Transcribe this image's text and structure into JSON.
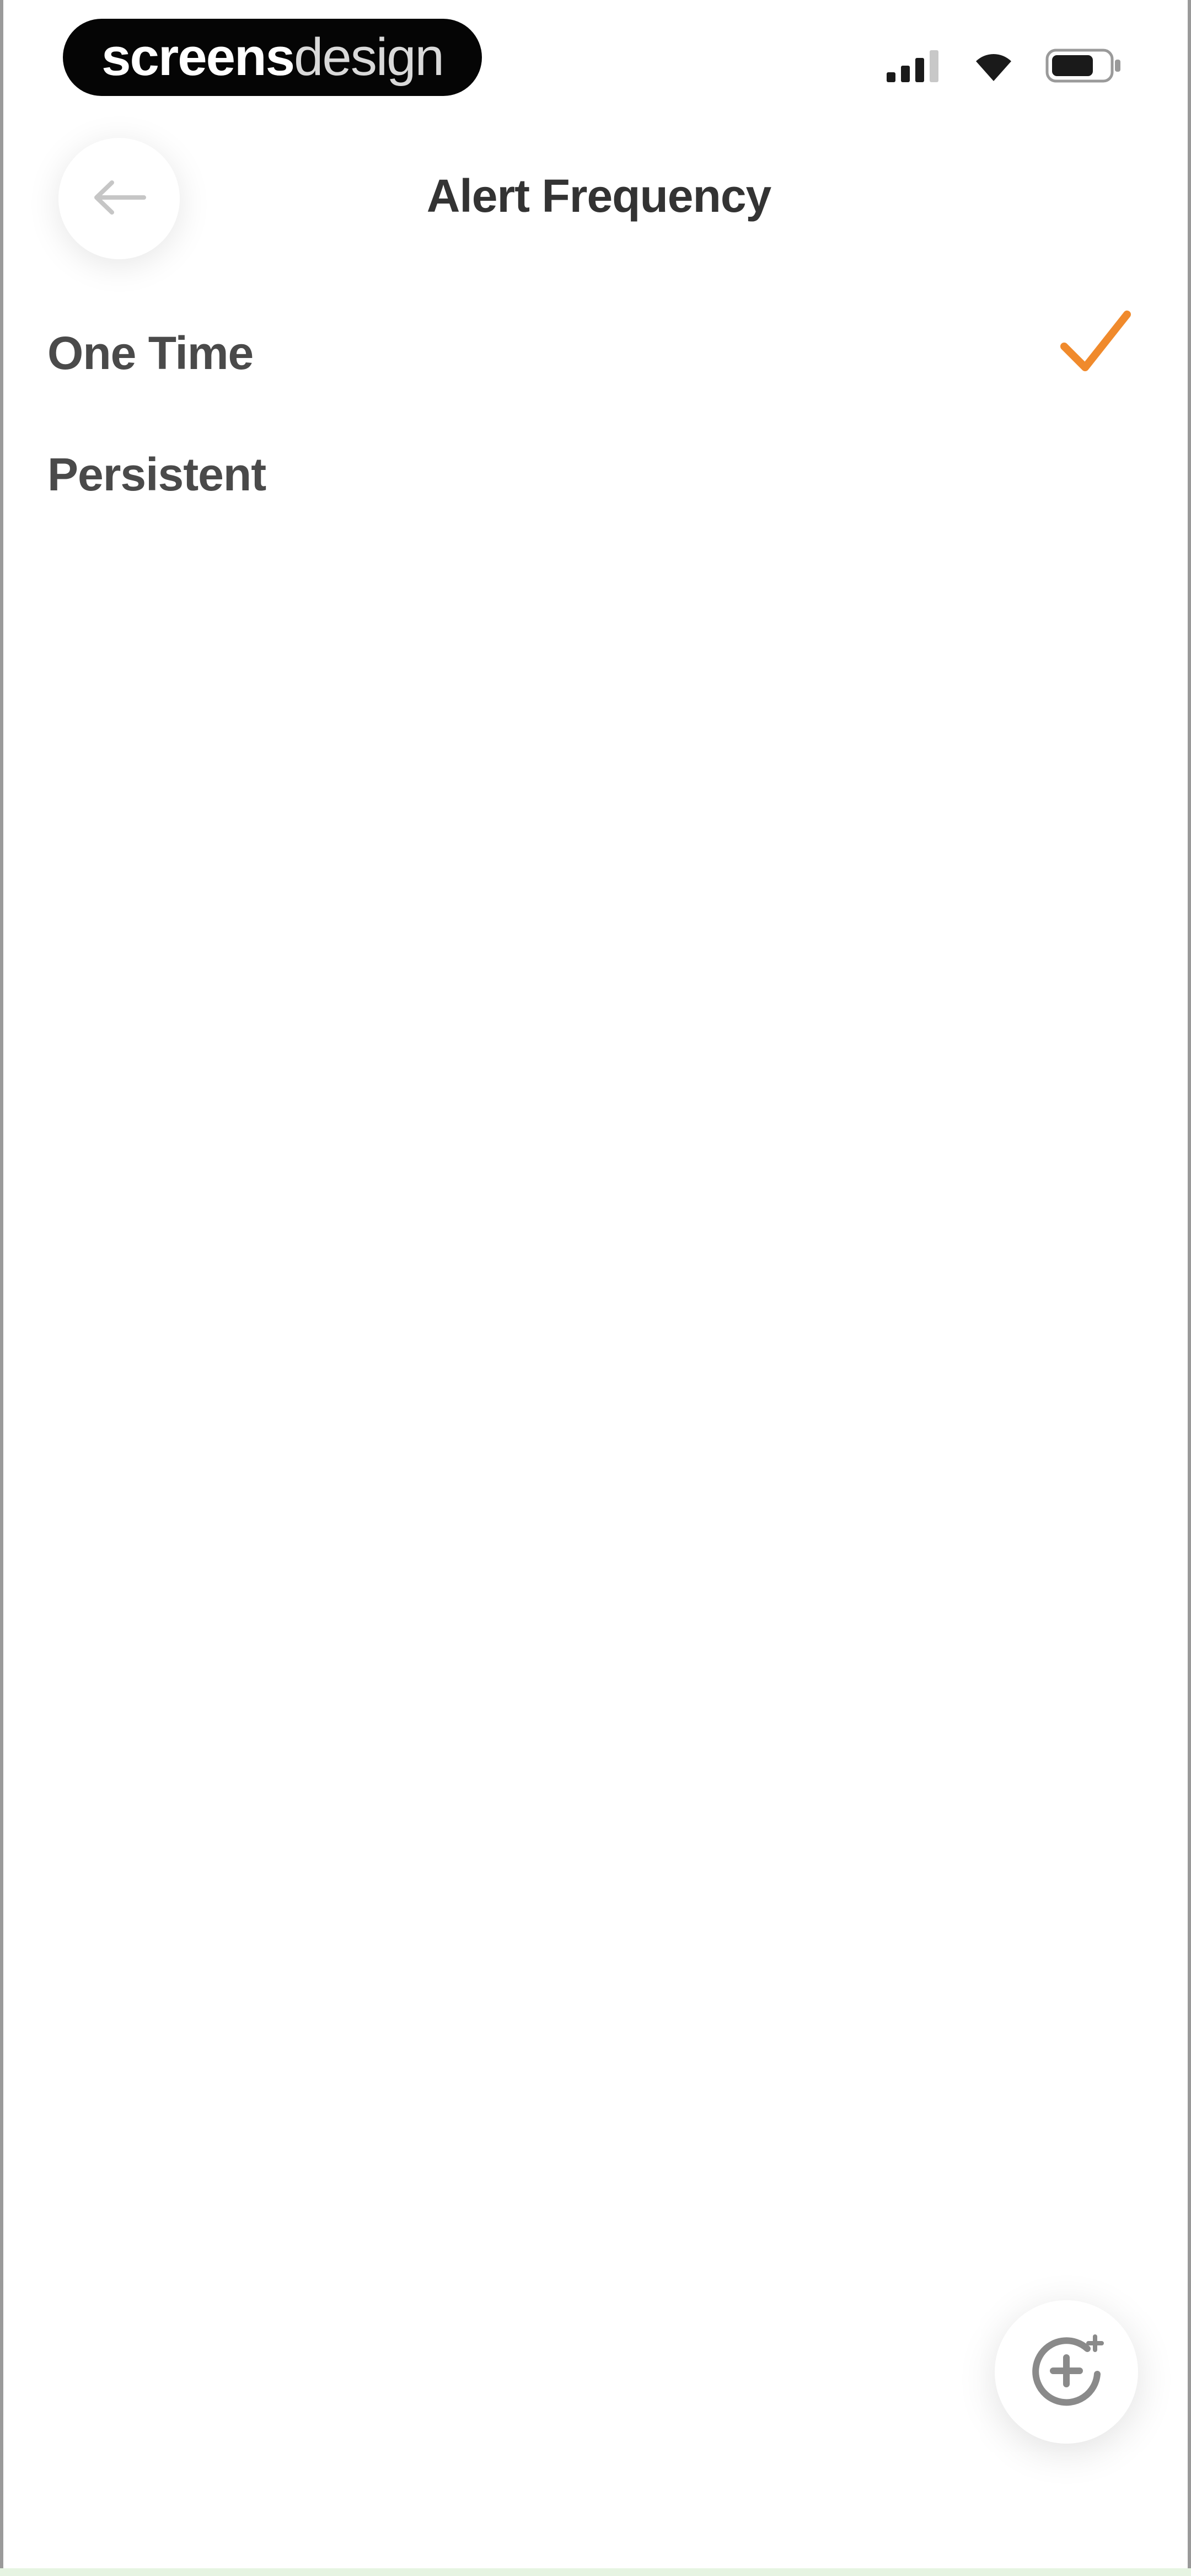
{
  "status_bar": {
    "brand_bold": "screens",
    "brand_light": "design",
    "icons": [
      "signal-icon",
      "wifi-icon",
      "battery-icon"
    ]
  },
  "header": {
    "title": "Alert Frequency",
    "back_icon": "arrow-left-icon"
  },
  "options": [
    {
      "label": "One Time",
      "selected": true
    },
    {
      "label": "Persistent",
      "selected": false
    }
  ],
  "fab": {
    "icon": "add-circle-sparkle-icon"
  },
  "colors": {
    "accent": "#F08A2C",
    "text": "#4a4a4a",
    "title": "#333333",
    "background": "#ffffff"
  }
}
